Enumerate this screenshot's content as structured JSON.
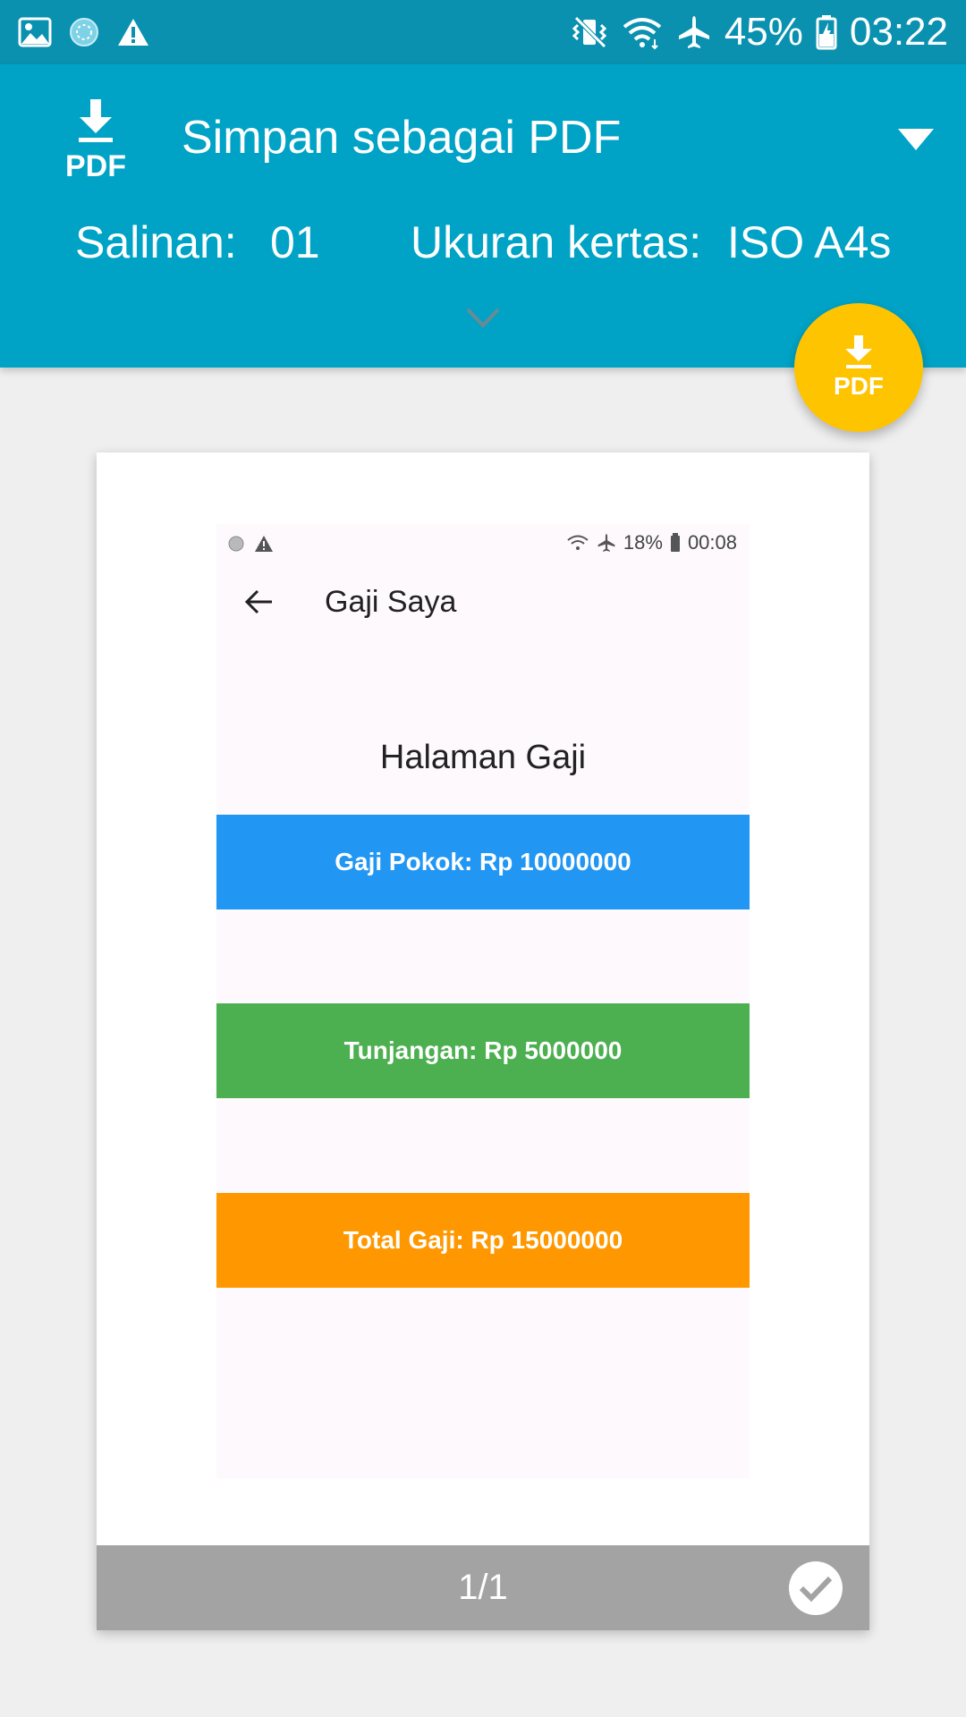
{
  "status_bar": {
    "battery": "45%",
    "time": "03:22",
    "icons": [
      "image-icon",
      "sync-icon",
      "warning-icon",
      "vibrate-icon",
      "wifi-icon",
      "airplane-icon",
      "battery-icon"
    ]
  },
  "print_header": {
    "printer_name": "Simpan sebagai PDF",
    "copies_label": "Salinan:",
    "copies_value": "01",
    "paper_label": "Ukuran kertas:",
    "paper_value": "ISO A4s",
    "pdf_icon_text": "PDF"
  },
  "fab": {
    "label": "PDF",
    "color": "#ffc400"
  },
  "preview": {
    "inner_status": {
      "battery": "18%",
      "time": "00:08"
    },
    "app_title": "Gaji Saya",
    "heading": "Halaman Gaji",
    "boxes": [
      {
        "text": "Gaji Pokok: Rp 10000000",
        "color": "#2196f3"
      },
      {
        "text": "Tunjangan: Rp 5000000",
        "color": "#4caf50"
      },
      {
        "text": "Total Gaji: Rp 15000000",
        "color": "#ff9800"
      }
    ],
    "page_count": "1/1"
  },
  "colors": {
    "header": "#00a3c6",
    "status_bar": "#0a91b0",
    "background": "#efefef"
  }
}
